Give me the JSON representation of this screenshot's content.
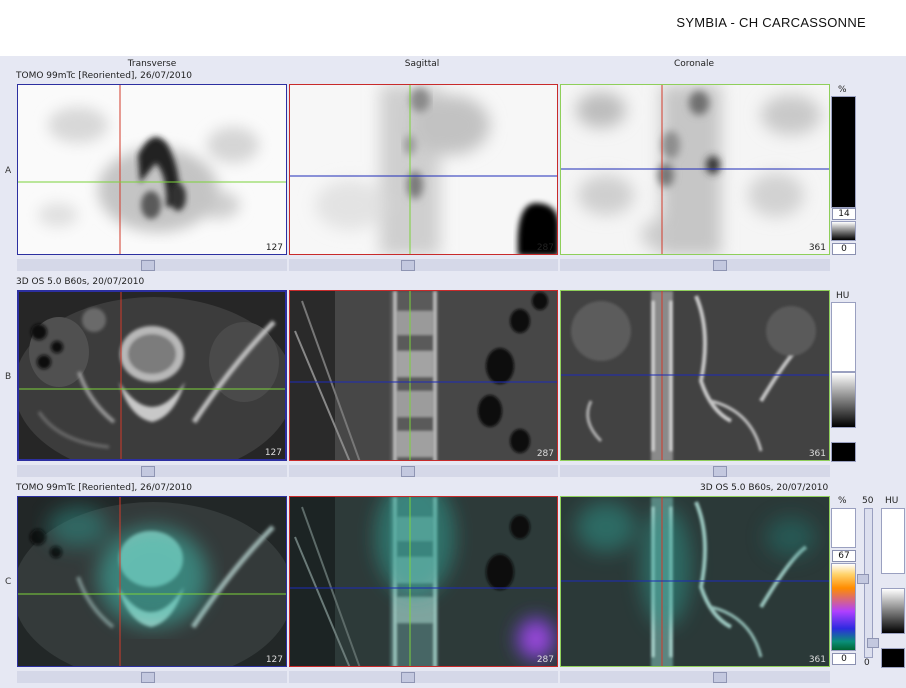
{
  "header": {
    "site_title": "SYMBIA - CH CARCASSONNE"
  },
  "columns": {
    "transverse": "Transverse",
    "sagittal": "Sagittal",
    "coronal": "Coronale"
  },
  "rows": {
    "a": {
      "label": "A",
      "series": "TOMO 99mTc [Reoriented], 26/07/2010"
    },
    "b": {
      "label": "B",
      "series": "3D  OS  5.0  B60s, 20/07/2010"
    },
    "c": {
      "label": "C",
      "series_left": "TOMO 99mTc [Reoriented], 26/07/2010",
      "series_right": "3D  OS  5.0  B60s, 20/07/2010"
    }
  },
  "slices": {
    "transverse": "127",
    "sagittal": "287",
    "coronal": "361"
  },
  "colorbars": {
    "a": {
      "unit": "%",
      "window": "14",
      "level": "0"
    },
    "b": {
      "unit": "HU"
    },
    "c": {
      "unit_pct": "%",
      "window_pct": "67",
      "level_pct": "0",
      "mid_value": "50",
      "unit_hu": "HU",
      "level_hu": "0"
    }
  },
  "colors": {
    "background": "#e6e8f3",
    "transverse_frame": "#2c2fa0",
    "sagittal_frame": "#c82a2a",
    "coronal_frame": "#8fcf5a",
    "crosshair_vertical": "#d23a2a",
    "crosshair_horizontal_green": "#7bd23a",
    "crosshair_horizontal_blue": "#1d2bb8"
  }
}
